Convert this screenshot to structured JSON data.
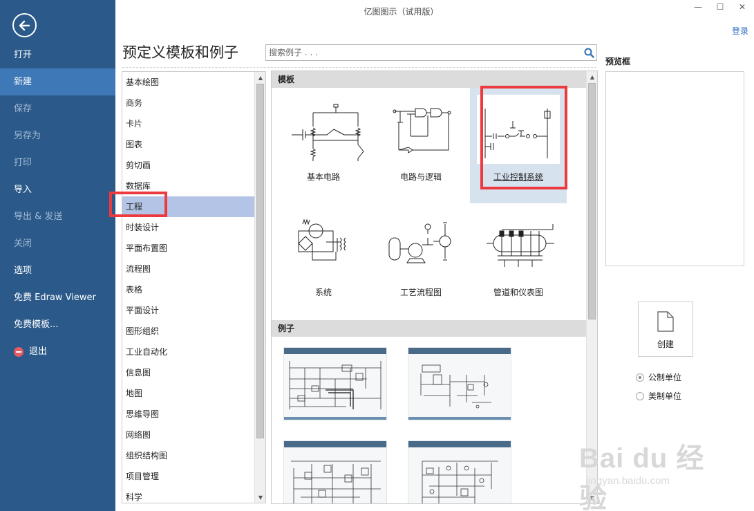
{
  "window": {
    "title": "亿图图示（试用版）",
    "login_label": "登录"
  },
  "sidebar": {
    "items": [
      {
        "label": "打开",
        "state": "normal"
      },
      {
        "label": "新建",
        "state": "active"
      },
      {
        "label": "保存",
        "state": "disabled"
      },
      {
        "label": "另存为",
        "state": "disabled"
      },
      {
        "label": "打印",
        "state": "disabled"
      },
      {
        "label": "导入",
        "state": "normal"
      },
      {
        "label": "导出 & 发送",
        "state": "disabled"
      },
      {
        "label": "关闭",
        "state": "disabled"
      },
      {
        "label": "选项",
        "state": "normal"
      },
      {
        "label": "免费 Edraw Viewer",
        "state": "normal"
      },
      {
        "label": "免费模板...",
        "state": "normal"
      },
      {
        "label": "退出",
        "state": "normal",
        "icon": "exit-icon"
      }
    ]
  },
  "main": {
    "heading": "预定义模板和例子",
    "search": {
      "placeholder": "搜索例子 . . .",
      "value": ""
    },
    "categories": [
      "基本绘图",
      "商务",
      "卡片",
      "图表",
      "剪切画",
      "数据库",
      "工程",
      "时装设计",
      "平面布置图",
      "流程图",
      "表格",
      "平面设计",
      "图形组织",
      "工业自动化",
      "信息图",
      "地图",
      "思维导图",
      "网络图",
      "组织结构图",
      "项目管理",
      "科学"
    ],
    "selected_category": "工程",
    "templates_header": "模板",
    "templates": [
      "基本电路",
      "电路与逻辑",
      "工业控制系统",
      "系统",
      "工艺流程图",
      "管道和仪表图"
    ],
    "selected_template": "工业控制系统",
    "examples_header": "例子"
  },
  "preview": {
    "label": "预览框",
    "create_label": "创建",
    "units": [
      {
        "label": "公制单位",
        "checked": true
      },
      {
        "label": "美制单位",
        "checked": false
      }
    ]
  },
  "watermark": {
    "main": "Bai du 经验",
    "sub": "jingyan.baidu.com"
  },
  "colors": {
    "sidebar_bg": "#2b5a8a",
    "sidebar_active": "#3f78b6",
    "selected_category": "#b3c4e6",
    "highlight": "#ec3a3f",
    "link": "#2b6cc4"
  }
}
